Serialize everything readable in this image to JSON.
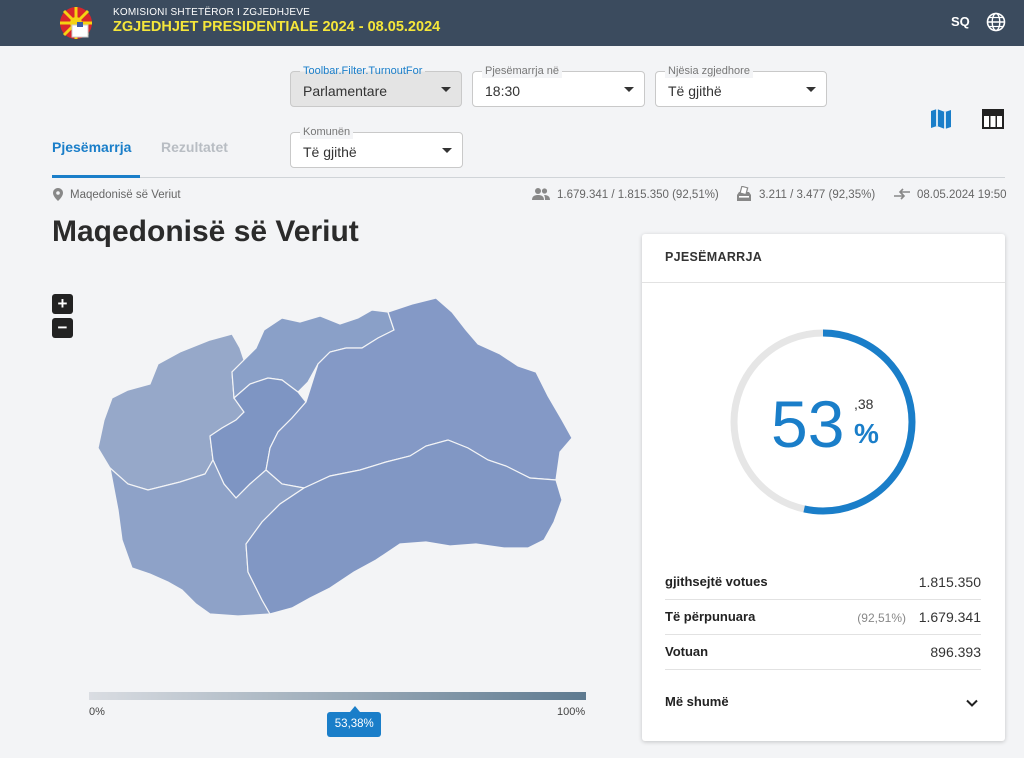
{
  "header": {
    "org": "KOMISIONI SHTETËROR I ZGJEDHJEVE",
    "election": "ZGJEDHJET PRESIDENTIALE 2024 - 08.05.2024",
    "lang": "SQ"
  },
  "filters": {
    "turnout_for": {
      "label": "Toolbar.Filter.TurnoutFor",
      "value": "Parlamentare"
    },
    "turnout_at": {
      "label": "Pjesëmarrja në",
      "value": "18:30"
    },
    "unit": {
      "label": "Njësia zgjedhore",
      "value": "Të gjithë"
    },
    "municipality": {
      "label": "Komunën",
      "value": "Të gjithë"
    }
  },
  "tabs": [
    {
      "label": "Pjesëmarrja",
      "active": true
    },
    {
      "label": "Rezultatet",
      "active": false
    }
  ],
  "breadcrumb": "Maqedonisë së Veriut",
  "stats": {
    "voters": "1.679.341 / 1.815.350 (92,51%)",
    "stations": "3.211 / 3.477 (92,35%)",
    "updated": "08.05.2024 19:50"
  },
  "page_title": "Maqedonisë së Veriut",
  "legend": {
    "min": "0%",
    "max": "100%",
    "marker": "53,38%",
    "marker_value": 53.38
  },
  "card": {
    "title": "PJESËMARRJA",
    "percent_int": "53",
    "percent_dec": ",38",
    "percent_sign": "%",
    "percent_value": 53.38,
    "rows": [
      {
        "label": "gjithsejtë votues",
        "value": "1.815.350",
        "extra": ""
      },
      {
        "label": "Të përpunuara",
        "value": "1.679.341",
        "extra": "(92,51%)"
      },
      {
        "label": "Votuan",
        "value": "896.393",
        "extra": ""
      }
    ],
    "more": "Më shumë"
  },
  "colors": {
    "accent": "#1a7ec9",
    "header": "#3b4b5e",
    "highlight": "#f5e63a"
  }
}
